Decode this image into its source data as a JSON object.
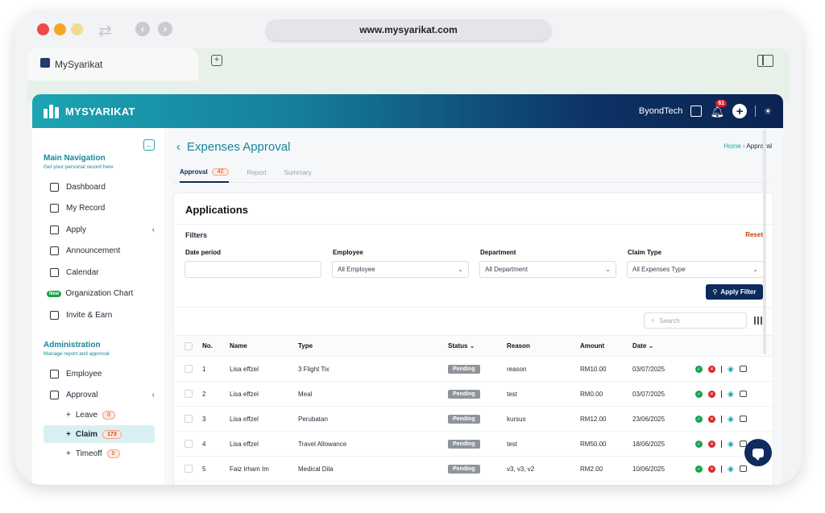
{
  "browser": {
    "url": "www.mysyarikat.com",
    "tab_title": "MySyarikat"
  },
  "app": {
    "brand": "MYSYARIKAT",
    "company": "ByondTech",
    "notification_count": "61",
    "accent": "#15879a",
    "primary": "#0d2b5c"
  },
  "sidebar": {
    "main_title": "Main Navigation",
    "main_sub": "Get your personal record here",
    "items": [
      {
        "label": "Dashboard",
        "icon": "dashboard-icon"
      },
      {
        "label": "My Record",
        "icon": "folder-icon"
      },
      {
        "label": "Apply",
        "icon": "apply-icon"
      },
      {
        "label": "Announcement",
        "icon": "announcement-icon"
      },
      {
        "label": "Calendar",
        "icon": "calendar-icon"
      },
      {
        "label": "Organization Chart",
        "icon": "org-chart-icon",
        "badge": "New"
      },
      {
        "label": "Invite & Earn",
        "icon": "gift-icon"
      }
    ],
    "admin_title": "Administration",
    "admin_sub": "Manage report and approval",
    "admin_items": [
      {
        "label": "Employee",
        "icon": "people-icon"
      },
      {
        "label": "Approval",
        "icon": "check-square-icon"
      }
    ],
    "sub_items": [
      {
        "label": "Leave",
        "count": "0"
      },
      {
        "label": "Claim",
        "count": "173"
      },
      {
        "label": "Timeoff",
        "count": "0"
      }
    ]
  },
  "page": {
    "title": "Expenses Approval",
    "breadcrumb_home": "Home",
    "breadcrumb_current": "Approval",
    "tabs": [
      {
        "label": "Approval",
        "badge": "42"
      },
      {
        "label": "Report"
      },
      {
        "label": "Summary"
      }
    ]
  },
  "card": {
    "title": "Applications",
    "filters_label": "Filters",
    "reset": "Reset",
    "filters": [
      {
        "label": "Date period",
        "value": ""
      },
      {
        "label": "Employee",
        "value": "All Employee"
      },
      {
        "label": "Department",
        "value": "All Department"
      },
      {
        "label": "Claim Type",
        "value": "All Expenses Type"
      }
    ],
    "apply_label": "Apply Filter",
    "search_placeholder": "Search"
  },
  "table": {
    "headers": {
      "no": "No.",
      "name": "Name",
      "type": "Type",
      "status": "Status",
      "reason": "Reason",
      "amount": "Amount",
      "date": "Date"
    },
    "rows": [
      {
        "no": "1",
        "name": "Lisa effzel",
        "type": "3 Flight Tix",
        "status": "Pending",
        "reason": "reason",
        "amount": "RM10.00",
        "date": "03/07/2025"
      },
      {
        "no": "2",
        "name": "Lisa effzel",
        "type": "Meal",
        "status": "Pending",
        "reason": "test",
        "amount": "RM0.00",
        "date": "03/07/2025"
      },
      {
        "no": "3",
        "name": "Lisa effzel",
        "type": "Perubatan",
        "status": "Pending",
        "reason": "kursus",
        "amount": "RM12.00",
        "date": "23/06/2025"
      },
      {
        "no": "4",
        "name": "Lisa effzel",
        "type": "Travel Allowance",
        "status": "Pending",
        "reason": "test",
        "amount": "RM50.00",
        "date": "18/06/2025"
      },
      {
        "no": "5",
        "name": "Faiz Irham Im",
        "type": "Medical Dila",
        "status": "Pending",
        "reason": "v3, v3, v2",
        "amount": "RM2.00",
        "date": "10/06/2025"
      }
    ]
  }
}
